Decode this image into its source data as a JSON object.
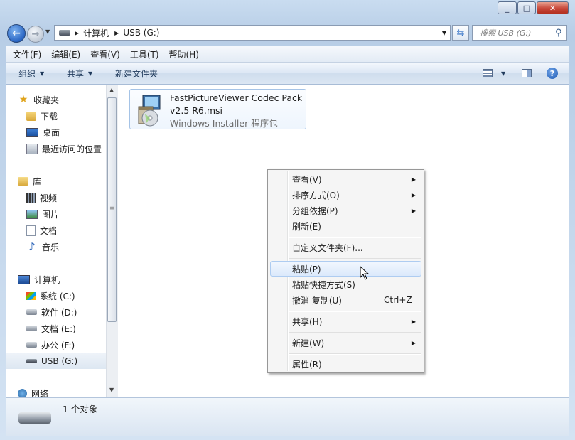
{
  "nav": {
    "back_icon": "back-arrow-icon",
    "forward_icon": "forward-arrow-icon",
    "breadcrumb": [
      "计算机",
      "USB (G:)"
    ],
    "search_placeholder": "搜索 USB (G:)"
  },
  "menubar": [
    "文件(F)",
    "编辑(E)",
    "查看(V)",
    "工具(T)",
    "帮助(H)"
  ],
  "toolbar": {
    "organize": "组织",
    "share": "共享",
    "new_folder": "新建文件夹"
  },
  "sidebar": {
    "favorites": {
      "label": "收藏夹",
      "items": [
        "下载",
        "桌面",
        "最近访问的位置"
      ]
    },
    "libraries": {
      "label": "库",
      "items": [
        "视频",
        "图片",
        "文档",
        "音乐"
      ]
    },
    "computer": {
      "label": "计算机",
      "items": [
        "系统 (C:)",
        "软件 (D:)",
        "文档 (E:)",
        "办公 (F:)",
        "USB (G:)"
      ],
      "selected": "USB (G:)"
    },
    "network": {
      "label": "网络"
    }
  },
  "file": {
    "name_line1": "FastPictureViewer Codec Pack",
    "name_line2": "v2.5 R6.msi",
    "type": "Windows Installer 程序包"
  },
  "status": {
    "count": "1 个对象"
  },
  "context_menu": {
    "view": "查看(V)",
    "sort": "排序方式(O)",
    "group": "分组依据(P)",
    "refresh": "刷新(E)",
    "customize": "自定义文件夹(F)...",
    "paste": "粘贴(P)",
    "paste_shortcut": "粘贴快捷方式(S)",
    "undo": "撤消 复制(U)",
    "undo_shortcut": "Ctrl+Z",
    "share": "共享(H)",
    "new": "新建(W)",
    "properties": "属性(R)"
  }
}
